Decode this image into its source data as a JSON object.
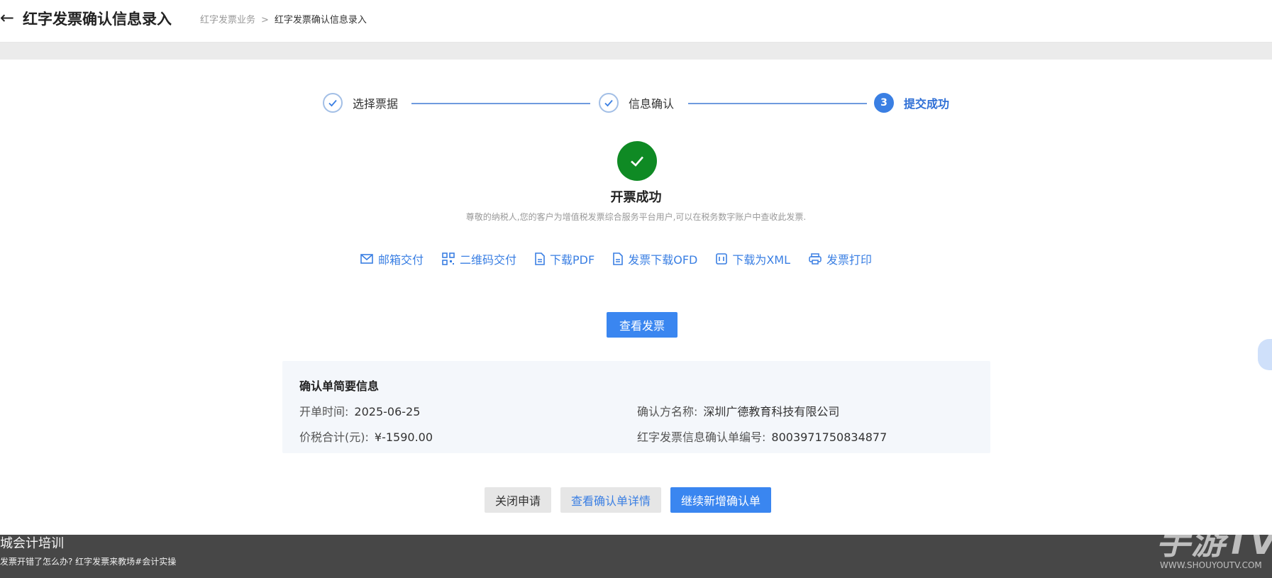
{
  "header": {
    "back_icon": "←",
    "title": "红字发票确认信息录入",
    "breadcrumb": [
      "红字发票业务",
      "红字发票确认信息录入"
    ],
    "breadcrumb_sep": ">"
  },
  "steps": [
    {
      "label": "选择票据",
      "state": "done"
    },
    {
      "label": "信息确认",
      "state": "done"
    },
    {
      "label": "提交成功",
      "state": "active",
      "number": "3"
    }
  ],
  "success": {
    "title": "开票成功",
    "description": "尊敬的纳税人,您的客户为增值税发票综合服务平台用户,可以在税务数字账户中查收此发票."
  },
  "actions": [
    {
      "icon": "mail-icon",
      "label": "邮箱交付"
    },
    {
      "icon": "qrcode-icon",
      "label": "二维码交付"
    },
    {
      "icon": "file-icon",
      "label": "下载PDF"
    },
    {
      "icon": "file-icon",
      "label": "发票下载OFD"
    },
    {
      "icon": "xml-icon",
      "label": "下载为XML"
    },
    {
      "icon": "printer-icon",
      "label": "发票打印"
    }
  ],
  "view_invoice_label": "查看发票",
  "summary": {
    "title": "确认单简要信息",
    "open_time_label": "开单时间:",
    "open_time_value": "2025-06-25",
    "total_label": "价税合计(元):",
    "total_value": "¥-1590.00",
    "confirmer_label": "确认方名称:",
    "confirmer_value": "深圳广德教育科技有限公司",
    "number_label": "红字发票信息确认单编号:",
    "number_value": "8003971750834877"
  },
  "bottom_buttons": {
    "close": "关闭申请",
    "details": "查看确认单详情",
    "continue": "继续新增确认单"
  },
  "overlay": {
    "caption_line1": "城会计培训",
    "caption_line2": "发票开错了怎么办?  红字发票来教场#会计实操",
    "watermark_logo": "手游TV",
    "watermark_url": "WWW.SHOUYOUTV.COM"
  },
  "colors": {
    "accent": "#3a86f0",
    "success": "#0f8a24",
    "link": "#3a7fe3"
  }
}
